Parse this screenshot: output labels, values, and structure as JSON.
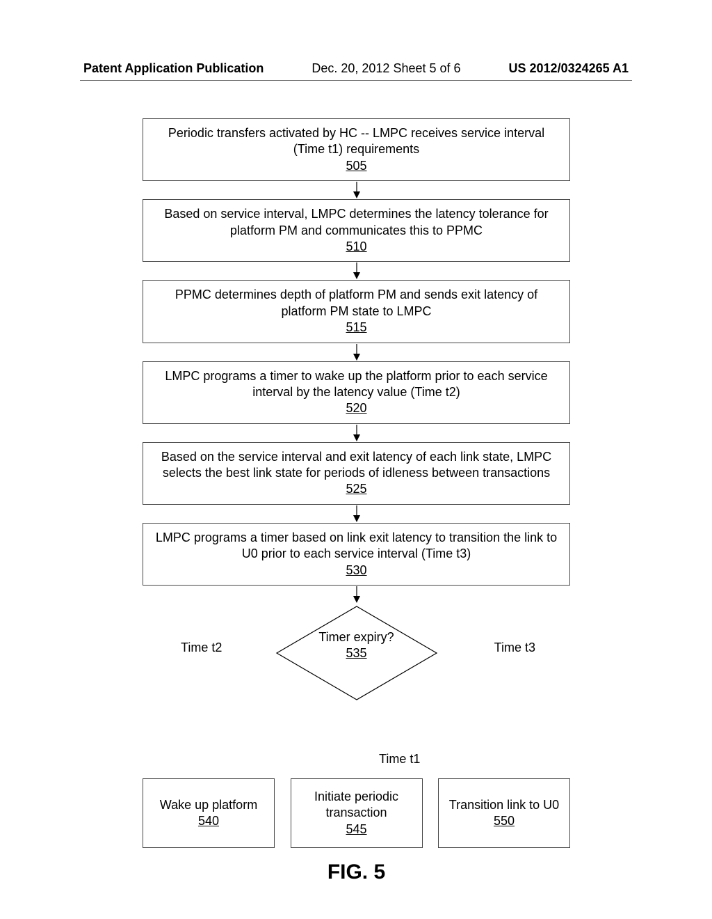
{
  "header": {
    "left": "Patent Application Publication",
    "mid": "Dec. 20, 2012  Sheet 5 of 6",
    "right": "US 2012/0324265 A1"
  },
  "chart_data": {
    "type": "flowchart",
    "nodes": [
      {
        "id": "505",
        "type": "process",
        "text": "Periodic transfers activated by HC -- LMPC receives service interval (Time t1) requirements",
        "ref": "505"
      },
      {
        "id": "510",
        "type": "process",
        "text": "Based on service interval, LMPC determines the latency tolerance for platform PM and communicates this to PPMC",
        "ref": "510"
      },
      {
        "id": "515",
        "type": "process",
        "text": "PPMC determines depth of platform PM and sends exit latency of platform PM state to LMPC",
        "ref": "515"
      },
      {
        "id": "520",
        "type": "process",
        "text": "LMPC programs a timer to wake up the platform prior to each service interval by the latency value (Time t2)",
        "ref": "520"
      },
      {
        "id": "525",
        "type": "process",
        "text": "Based on the service interval and exit latency of each link state, LMPC selects the best link state for periods of idleness between transactions",
        "ref": "525"
      },
      {
        "id": "530",
        "type": "process",
        "text": "LMPC programs a timer based on link exit latency to transition the link to U0 prior to each service interval (Time t3)",
        "ref": "530"
      },
      {
        "id": "535",
        "type": "decision",
        "text": "Timer expiry?",
        "ref": "535"
      },
      {
        "id": "540",
        "type": "process",
        "text": "Wake up platform",
        "ref": "540"
      },
      {
        "id": "545",
        "type": "process",
        "text": "Initiate periodic transaction",
        "ref": "545"
      },
      {
        "id": "550",
        "type": "process",
        "text": "Transition link to U0",
        "ref": "550"
      }
    ],
    "edges": [
      {
        "from": "505",
        "to": "510"
      },
      {
        "from": "510",
        "to": "515"
      },
      {
        "from": "515",
        "to": "520"
      },
      {
        "from": "520",
        "to": "525"
      },
      {
        "from": "525",
        "to": "530"
      },
      {
        "from": "530",
        "to": "535"
      },
      {
        "from": "535",
        "to": "540",
        "label": "Time t2"
      },
      {
        "from": "535",
        "to": "545",
        "label": "Time t1"
      },
      {
        "from": "535",
        "to": "550",
        "label": "Time t3"
      }
    ],
    "figure_label": "FIG. 5"
  },
  "labels": {
    "t1": "Time t1",
    "t2": "Time t2",
    "t3": "Time t3"
  }
}
